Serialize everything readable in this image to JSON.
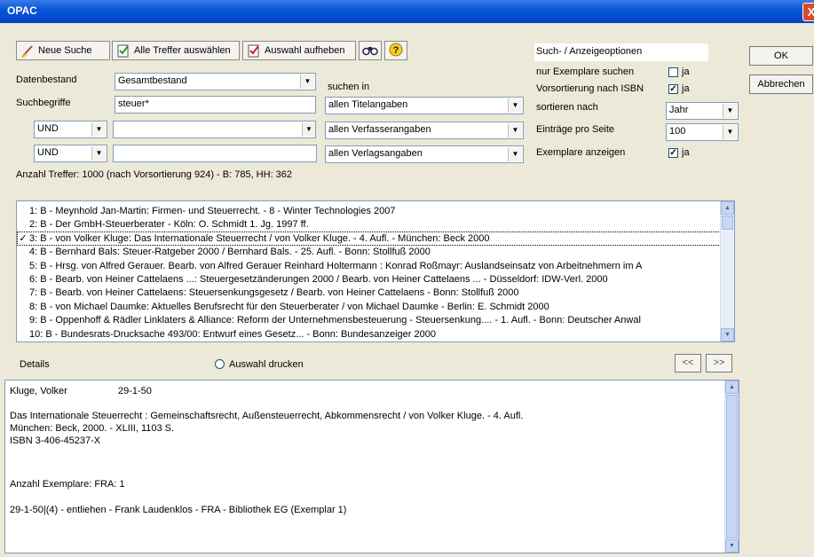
{
  "window": {
    "title": "OPAC",
    "close_glyph": "X"
  },
  "toolbar": {
    "new_search": "Neue Suche",
    "select_all": "Alle Treffer auswählen",
    "deselect": "Auswahl aufheben"
  },
  "form": {
    "datenbestand_label": "Datenbestand",
    "datenbestand_value": "Gesamtbestand",
    "suchbegriffe_label": "Suchbegriffe",
    "suchbegriff1": "steuer*",
    "suchen_in_label": "suchen in",
    "op2": "UND",
    "op3": "UND",
    "suchbegriff2": "",
    "suchbegriff3": "",
    "field1": "allen Titelangaben",
    "field2": "allen Verfasserangaben",
    "field3": "allen Verlagsangaben"
  },
  "options": {
    "header": "Such- / Anzeigeoptionen",
    "only_copies_label": "nur Exemplare suchen",
    "only_copies_ja": "ja",
    "only_copies_checked": false,
    "presort_label": "Vorsortierung nach ISBN",
    "presort_ja": "ja",
    "presort_checked": true,
    "sort_label": "sortieren nach",
    "sort_value": "Jahr",
    "per_page_label": "Einträge pro Seite",
    "per_page_value": "100",
    "show_copies_label": "Exemplare anzeigen",
    "show_copies_ja": "ja",
    "show_copies_checked": true
  },
  "buttons": {
    "ok": "OK",
    "cancel": "Abbrechen",
    "prev": "<<",
    "next": ">>"
  },
  "hits": "Anzahl Treffer: 1000 (nach Vorsortierung 924) - B: 785, HH: 362",
  "results": [
    {
      "mark": "",
      "text": "1: B - Meynhold Jan-Martin: Firmen- und Steuerrecht. - 8 - Winter Technologies 2007"
    },
    {
      "mark": "",
      "text": "2: B - Der GmbH-Steuerberater - Köln: O. Schmidt 1. Jg. 1997 ff."
    },
    {
      "mark": "✓",
      "text": "3: B - von Volker Kluge: Das Internationale Steuerrecht / von Volker Kluge. - 4. Aufl. - München: Beck 2000"
    },
    {
      "mark": "",
      "text": "4: B - Bernhard Bals: Steuer-Ratgeber 2000 / Bernhard Bals. - 25. Aufl. - Bonn: Stollfuß 2000"
    },
    {
      "mark": "",
      "text": "5: B - Hrsg. von Alfred Gerauer. Bearb. von Alfred Gerauer  Reinhard Holtermann : Konrad Roßmayr: Auslandseinsatz von Arbeitnehmern im A"
    },
    {
      "mark": "",
      "text": "6: B - Bearb. von Heiner Cattelaens ...: Steuergesetzänderungen 2000 / Bearb. von Heiner Cattelaens ... - Düsseldorf: IDW-Verl. 2000"
    },
    {
      "mark": "",
      "text": "7: B - Bearb. von Heiner Cattelaens: Steuersenkungsgesetz / Bearb. von Heiner Cattelaens  - Bonn: Stollfuß 2000"
    },
    {
      "mark": "",
      "text": "8: B - von Michael Daumke: Aktuelles Berufsrecht für den Steuerberater / von Michael Daumke - Berlin: E. Schmidt 2000"
    },
    {
      "mark": "",
      "text": "9: B - Oppenhoff & Rädler Linklaters & Alliance: Reform der Unternehmensbesteuerung - Steuersenkung.... - 1. Aufl. - Bonn: Deutscher Anwal"
    },
    {
      "mark": "",
      "text": "10: B - Bundesrats-Drucksache 493/00: Entwurf eines Gesetz... - Bonn: Bundesanzeiger 2000"
    }
  ],
  "selected_index": 2,
  "details": {
    "label": "Details",
    "print_label": "Auswahl drucken",
    "author": "Kluge, Volker",
    "signature": "29-1-50",
    "line1": "Das Internationale Steuerrecht : Gemeinschaftsrecht, Außensteuerrecht, Abkommensrecht / von Volker Kluge. - 4. Aufl.",
    "line2": "München: Beck, 2000. - XLIII, 1103 S.",
    "line3": "ISBN 3-406-45237-X",
    "copies": "Anzahl Exemplare:  FRA: 1",
    "copy_line": "29-1-50|(4) - entliehen - Frank Laudenklos - FRA - Bibliothek EG (Exemplar 1)"
  },
  "colors": {
    "title_bar": "#0a56d8",
    "window_bg": "#ece9d8"
  }
}
